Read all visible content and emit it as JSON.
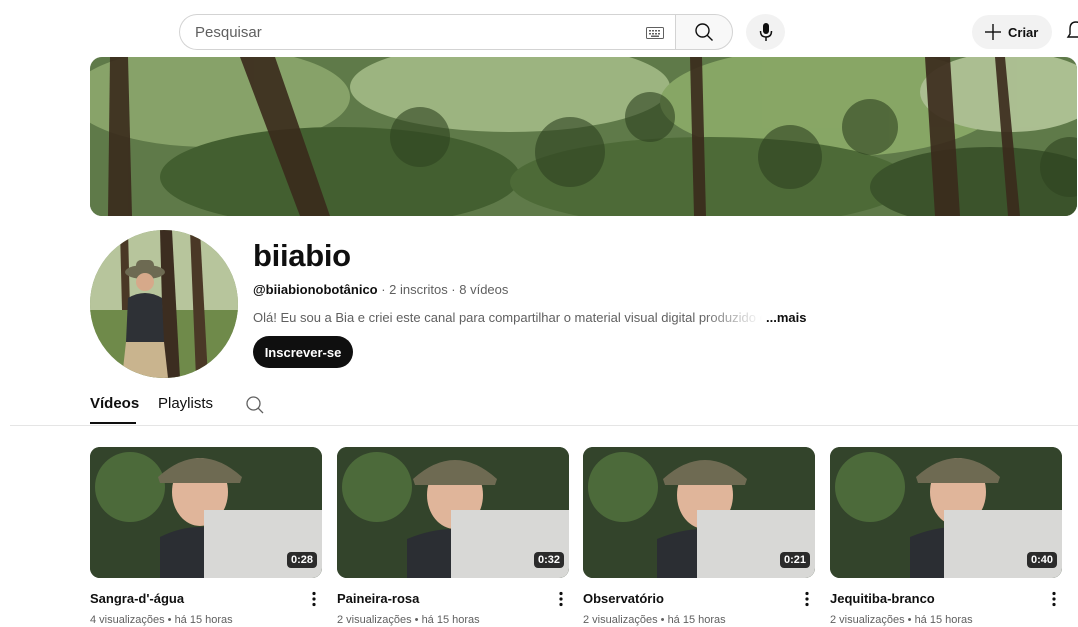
{
  "search": {
    "placeholder": "Pesquisar"
  },
  "header": {
    "create_label": "Criar"
  },
  "channel": {
    "name": "biiabio",
    "handle": "@biiabionobotânico",
    "stats": " · 2 inscritos · 8 vídeos",
    "description": "Olá! Eu sou a Bia e criei este canal para compartilhar o material visual digital produzido du",
    "more_label": "...mais",
    "subscribe_label": "Inscrever-se"
  },
  "tabs": [
    {
      "label": "Vídeos",
      "active": true
    },
    {
      "label": "Playlists",
      "active": false
    }
  ],
  "videos": [
    {
      "title": "Sangra-d'-água",
      "views": "4 visualizações",
      "age": "há 15 horas",
      "duration": "0:28"
    },
    {
      "title": "Paineira-rosa",
      "views": "2 visualizações",
      "age": "há 15 horas",
      "duration": "0:32"
    },
    {
      "title": "Observatório",
      "views": "2 visualizações",
      "age": "há 15 horas",
      "duration": "0:21"
    },
    {
      "title": "Jequitiba-branco",
      "views": "2 visualizações",
      "age": "há 15 horas",
      "duration": "0:40"
    }
  ],
  "colors": {
    "text": "#0f0f0f",
    "secondary": "#606060",
    "button_dark": "#0f0f0f",
    "chip": "#f2f2f2"
  }
}
